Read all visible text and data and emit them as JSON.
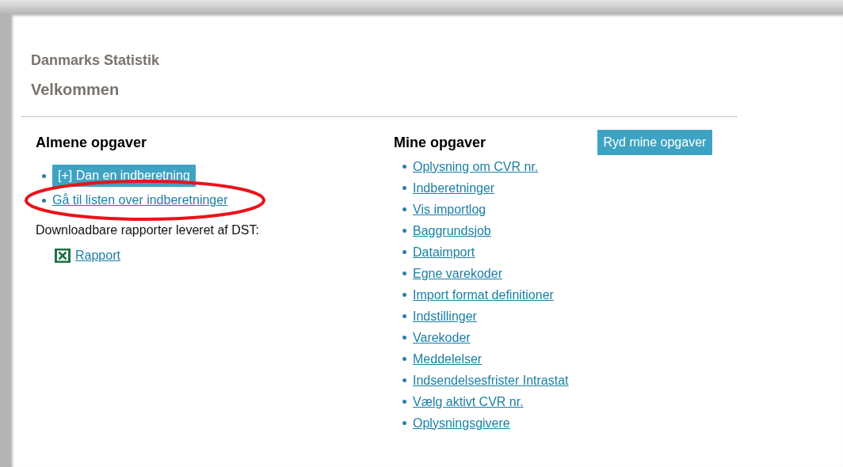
{
  "header": {
    "brand": "Danmarks Statistik",
    "title": "Velkommen"
  },
  "general_tasks": {
    "heading": "Almene opgaver",
    "items": [
      {
        "kind": "button",
        "label": "[+] Dan en indberetning",
        "highlighted": false
      },
      {
        "kind": "link",
        "label": "Gå til listen over indberetninger",
        "highlighted": true
      }
    ],
    "reports_label": "Downloadbare rapporter leveret af DST:",
    "reports": [
      {
        "label": "Rapport"
      }
    ]
  },
  "my_tasks": {
    "heading": "Mine opgaver",
    "clear_button": "Ryd mine opgaver",
    "links": [
      "Oplysning om CVR nr.",
      "Indberetninger",
      "Vis importlog",
      "Baggrundsjob",
      "Dataimport",
      "Egne varekoder",
      "Import format definitioner",
      "Indstillinger",
      "Varekoder",
      "Meddelelser",
      "Indsendelsesfrister Intrastat",
      "Vælg aktivt CVR nr.",
      "Oplysningsgivere"
    ]
  }
}
